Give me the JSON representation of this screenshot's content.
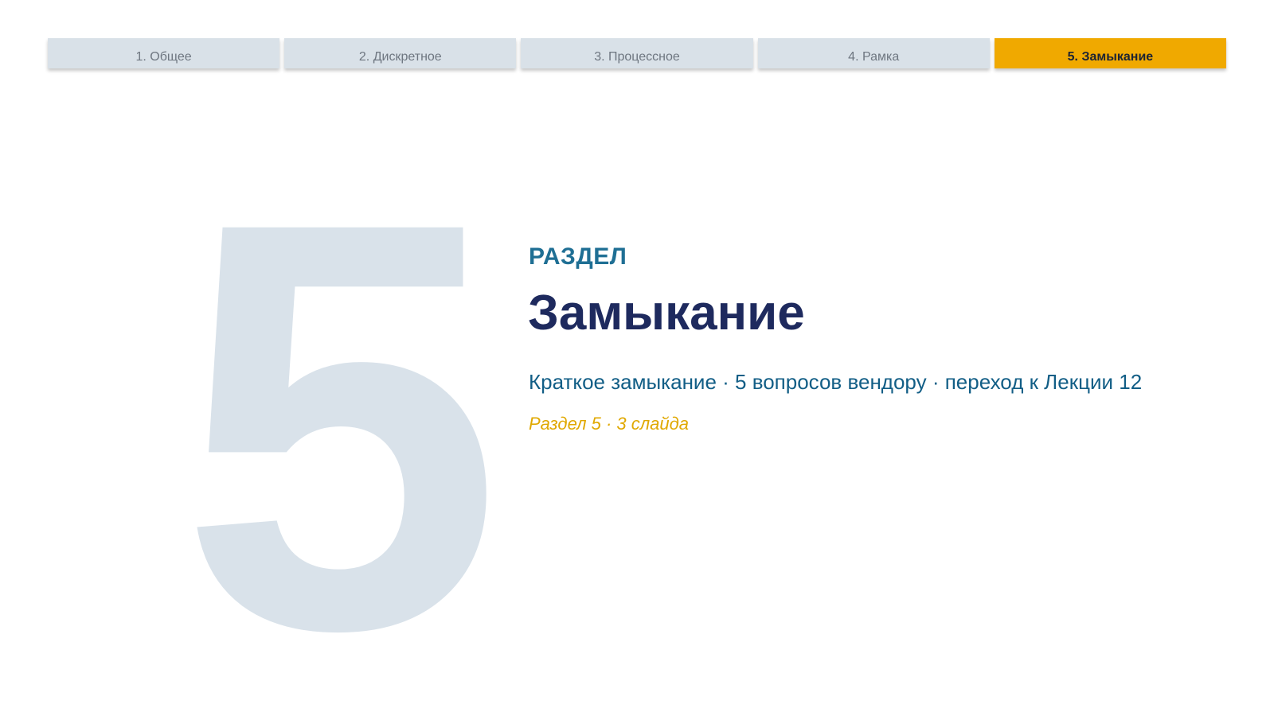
{
  "nav": {
    "tabs": [
      {
        "label": "1. Общее",
        "active": false
      },
      {
        "label": "2. Дискретное",
        "active": false
      },
      {
        "label": "3. Процессное",
        "active": false
      },
      {
        "label": "4. Рамка",
        "active": false
      },
      {
        "label": "5. Замыкание",
        "active": true
      }
    ]
  },
  "section": {
    "number": "5",
    "eyebrow": "РАЗДЕЛ",
    "title": "Замыкание",
    "subtitle": "Краткое замыкание · 5 вопросов вендору · переход к Лекции 12",
    "meta": "Раздел 5 · 3 слайда"
  },
  "colors": {
    "accent": "#f0a900",
    "title": "#1e2a5e",
    "eyebrow": "#1f6f94",
    "subtitle": "#125e86",
    "tab_inactive": "#d9e1e8",
    "big_number": "#d9e2ea"
  }
}
